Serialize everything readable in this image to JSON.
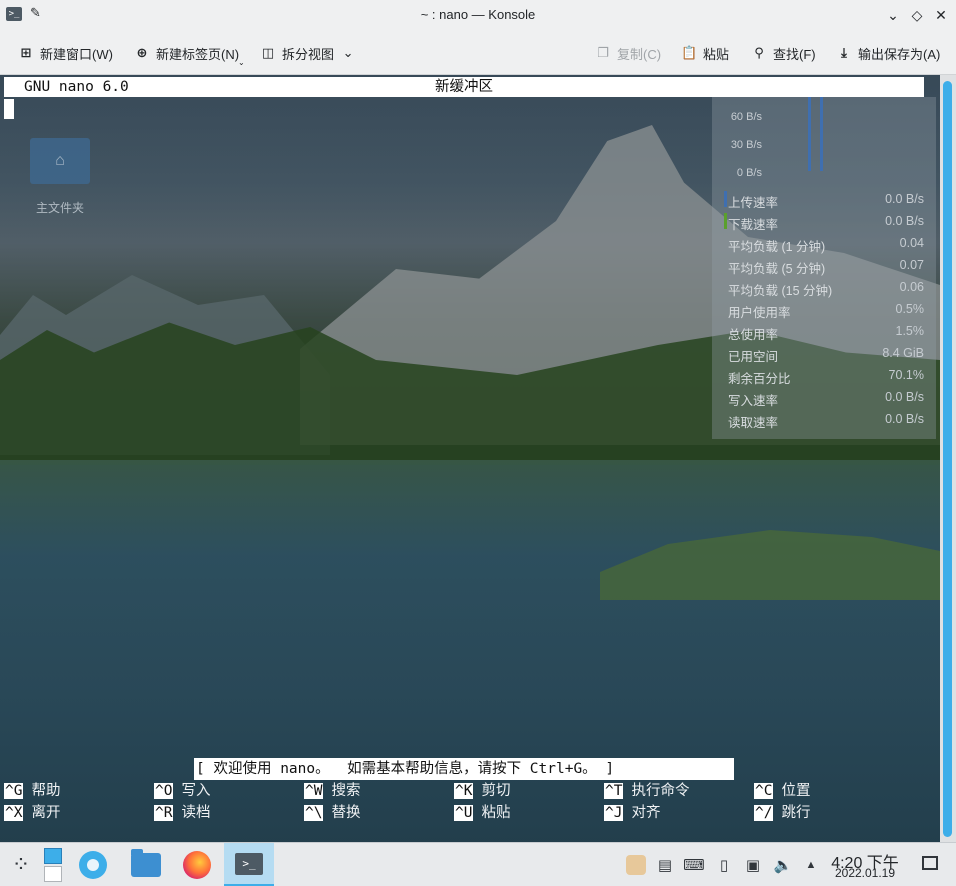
{
  "window": {
    "title": "~ : nano — Konsole",
    "app_icon": "konsole-icon",
    "pin_icon": "pin-icon",
    "controls": [
      "minimize-icon",
      "maximize-icon",
      "close-icon"
    ]
  },
  "toolbar": {
    "new_window": "新建窗口(W)",
    "new_tab": "新建标签页(N)",
    "split_view": "拆分视图",
    "copy": "复制(C)",
    "paste": "粘贴",
    "find": "查找(F)",
    "save_output": "输出保存为(A)"
  },
  "desktop": {
    "home_folder_label": "主文件夹"
  },
  "sysmon": {
    "graph_labels": [
      "60 B/s",
      "30 B/s",
      "0 B/s"
    ],
    "rows": [
      {
        "label": "上传速率",
        "value": "0.0 B/s",
        "color": "#3f6fb0"
      },
      {
        "label": "下载速率",
        "value": "0.0 B/s",
        "color": "#5aa02c"
      },
      {
        "label": "平均负载 (1 分钟)",
        "value": "0.04"
      },
      {
        "label": "平均负载 (5 分钟)",
        "value": "0.07"
      },
      {
        "label": "平均负载 (15 分钟)",
        "value": "0.06"
      },
      {
        "label": "用户使用率",
        "value": "0.5%"
      },
      {
        "label": "总使用率",
        "value": "1.5%"
      },
      {
        "label": "已用空间",
        "value": "8.4 GiB"
      },
      {
        "label": "剩余百分比",
        "value": "70.1%"
      },
      {
        "label": "写入速率",
        "value": "0.0 B/s"
      },
      {
        "label": "读取速率",
        "value": "0.0 B/s"
      }
    ]
  },
  "nano": {
    "version": "GNU nano 6.0",
    "buffer": "新缓冲区",
    "status": "[ 欢迎使用 nano。  如需基本帮助信息，请按下 Ctrl+G。 ]",
    "shortcuts": [
      {
        "key": "^G",
        "label": "帮助"
      },
      {
        "key": "^O",
        "label": "写入"
      },
      {
        "key": "^W",
        "label": "搜索"
      },
      {
        "key": "^K",
        "label": "剪切"
      },
      {
        "key": "^T",
        "label": "执行命令"
      },
      {
        "key": "^C",
        "label": "位置"
      },
      {
        "key": "^X",
        "label": "离开"
      },
      {
        "key": "^R",
        "label": "读档"
      },
      {
        "key": "^\\",
        "label": "替换"
      },
      {
        "key": "^U",
        "label": "粘贴"
      },
      {
        "key": "^J",
        "label": "对齐"
      },
      {
        "key": "^/",
        "label": "跳行"
      }
    ]
  },
  "taskbar": {
    "clock_time": "4:20 下午",
    "clock_date": "2022.01.19",
    "accent": "#3daee9"
  }
}
